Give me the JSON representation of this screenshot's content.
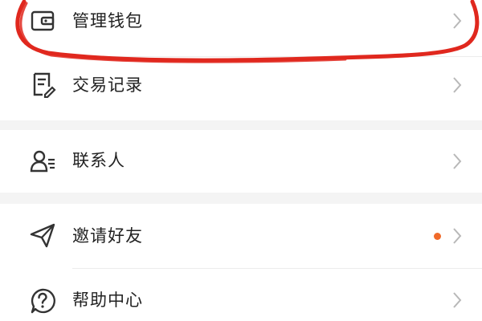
{
  "menu": {
    "items": [
      {
        "label": "管理钱包",
        "icon": "wallet-icon"
      },
      {
        "label": "交易记录",
        "icon": "transaction-record-icon"
      },
      {
        "label": "联系人",
        "icon": "contacts-icon"
      },
      {
        "label": "邀请好友",
        "icon": "paper-plane-icon",
        "has_notification_dot": true
      },
      {
        "label": "帮助中心",
        "icon": "help-icon"
      }
    ]
  },
  "colors": {
    "background": "#f4f4f4",
    "card": "#ffffff",
    "text": "#222222",
    "icon": "#333333",
    "chevron": "#b8b8b8",
    "notification_dot": "#f06a2a",
    "annotation_circle": "#e0281e"
  }
}
